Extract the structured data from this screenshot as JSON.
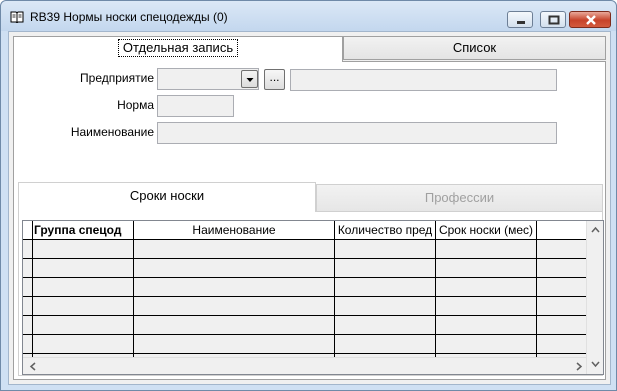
{
  "window": {
    "title": "RB39 Нормы носки спецодежды (0)",
    "icon": "book-icon",
    "controls": [
      "minimize-icon",
      "maximize-icon",
      "close-icon"
    ]
  },
  "main_tabs": [
    {
      "label": "Отдельная запись",
      "active": true
    },
    {
      "label": "Список",
      "active": false
    }
  ],
  "form": {
    "enterprise_label": "Предприятие",
    "enterprise_value": "",
    "enterprise_name": "",
    "lookup_button": "...",
    "norm_label": "Норма",
    "norm_value": "",
    "name_label": "Наименование",
    "name_value": ""
  },
  "sub_tabs": [
    {
      "label": "Сроки носки",
      "active": true,
      "enabled": true
    },
    {
      "label": "Профессии",
      "active": false,
      "enabled": false
    }
  ],
  "grid": {
    "columns": [
      "Группа спецод",
      "Наименование",
      "Количество пред",
      "Срок носки (мес)",
      ""
    ],
    "rows": 7
  },
  "colors": {
    "title_bar": "#c3d7ee",
    "close_button": "#c7432a",
    "field_bg": "#f0f0f0",
    "disabled_text": "#a0a0a0"
  }
}
